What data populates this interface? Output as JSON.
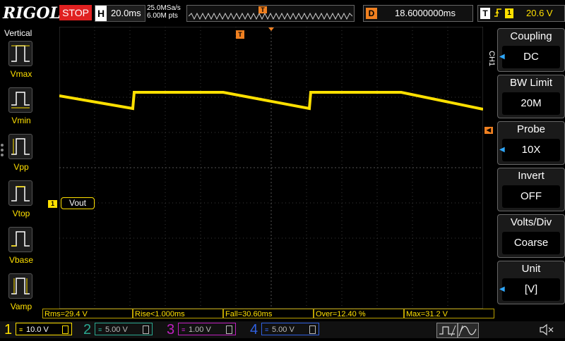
{
  "brand": "RIGOL",
  "run_state": "STOP",
  "horizontal": {
    "tag": "H",
    "timebase": "20.0ms",
    "sample_rate": "25.0MSa/s",
    "memory_depth": "6.00M pts"
  },
  "trigger_marker": "T",
  "delay": {
    "tag": "D",
    "value": "18.6000000ms"
  },
  "trigger": {
    "tag": "T",
    "edge": "rising-edge-icon",
    "source": "1",
    "level": "20.6 V"
  },
  "left_panel": {
    "title": "Vertical",
    "items": [
      {
        "label": "Vmax"
      },
      {
        "label": "Vmin"
      },
      {
        "label": "Vpp"
      },
      {
        "label": "Vtop"
      },
      {
        "label": "Vbase"
      },
      {
        "label": "Vamp"
      }
    ]
  },
  "channel_label": "CH1",
  "ch1_marker": "1",
  "waveform_label": "Vout",
  "right_menu": [
    {
      "title": "Coupling",
      "value": "DC",
      "has_arrow": true
    },
    {
      "title": "BW Limit",
      "value": "20M",
      "has_arrow": false
    },
    {
      "title": "Probe",
      "value": "10X",
      "has_arrow": true
    },
    {
      "title": "Invert",
      "value": "OFF",
      "has_arrow": false
    },
    {
      "title": "Volts/Div",
      "value": "Coarse",
      "has_arrow": false
    },
    {
      "title": "Unit",
      "value": "[V]",
      "has_arrow": true
    }
  ],
  "measurements": [
    {
      "text": "Rms=29.4 V"
    },
    {
      "text": "Rise<1.000ms"
    },
    {
      "text": "Fall=30.60ms"
    },
    {
      "text": "Over=12.40 %"
    },
    {
      "text": "Max=31.2 V"
    }
  ],
  "channels": [
    {
      "num": "1",
      "scale": "10.0 V",
      "color": "#ffe000",
      "active": true
    },
    {
      "num": "2",
      "scale": "5.00 V",
      "color": "#2aa890",
      "active": false
    },
    {
      "num": "3",
      "scale": "1.00 V",
      "color": "#c020c0",
      "active": false
    },
    {
      "num": "4",
      "scale": "5.00 V",
      "color": "#3060e0",
      "active": false
    }
  ],
  "colors": {
    "ch1": "#ffe000",
    "trigger": "#f08020",
    "stop": "#e02020",
    "accent": "#2fa8ff"
  }
}
